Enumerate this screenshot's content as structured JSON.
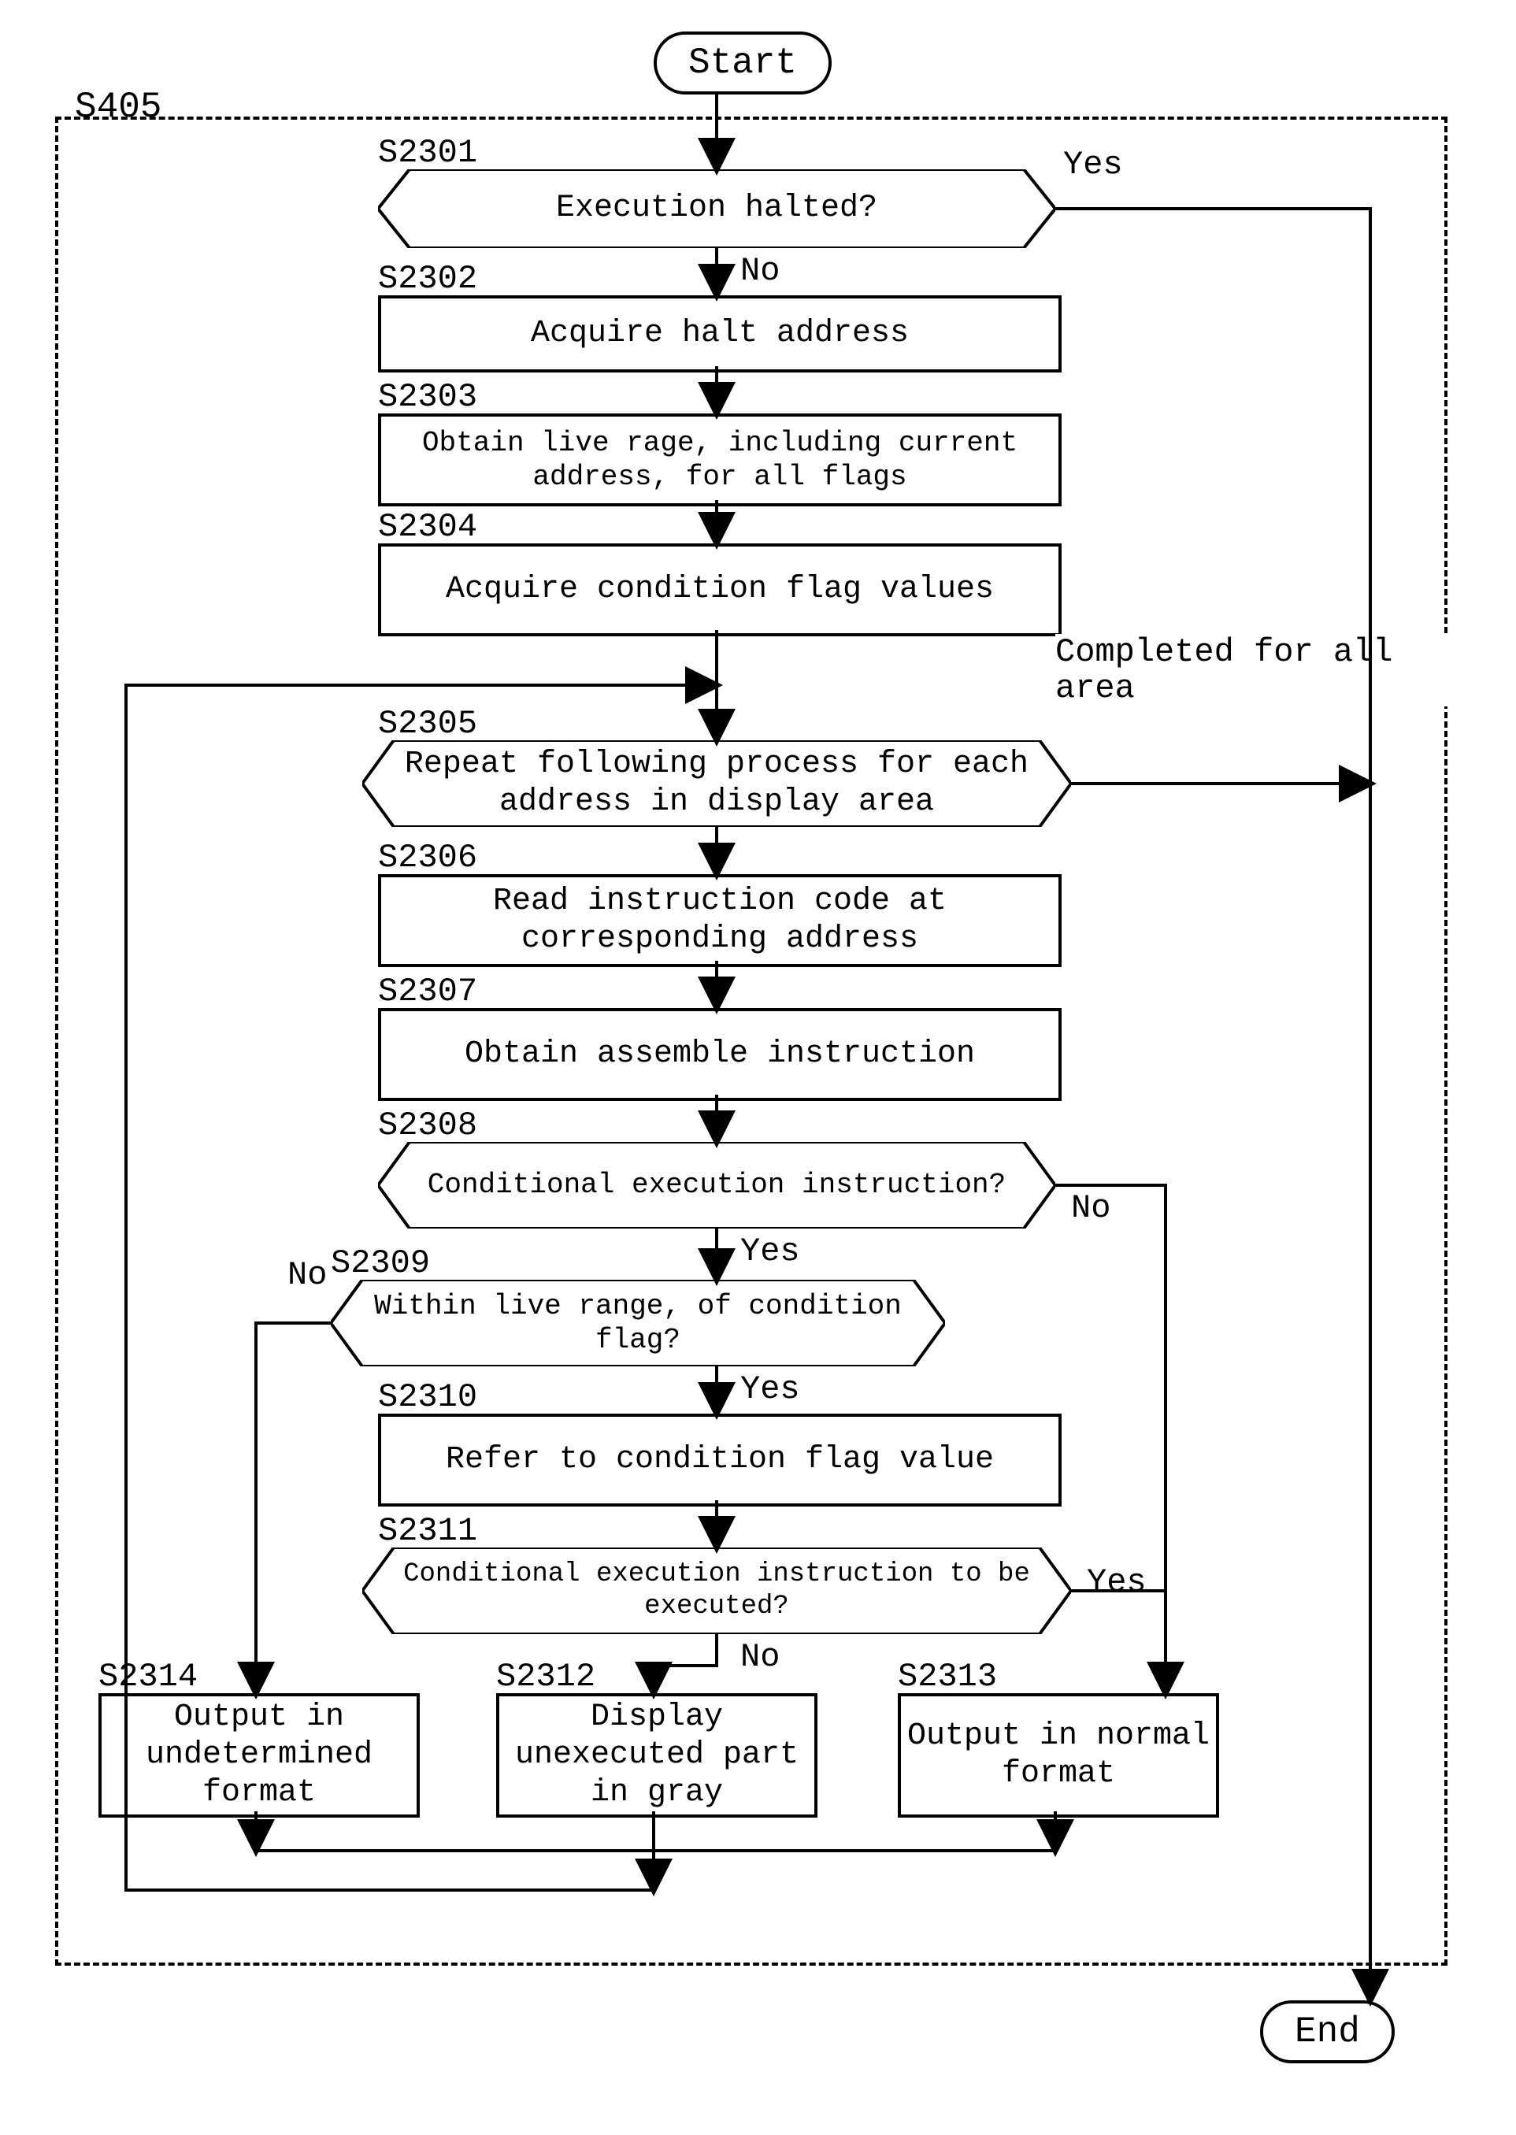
{
  "chart_data": {
    "type": "flowchart",
    "title": "S405",
    "nodes": [
      {
        "id": "start",
        "type": "terminal",
        "label": "Start"
      },
      {
        "id": "S2301",
        "type": "decision",
        "label": "Execution halted?",
        "step": "S2301"
      },
      {
        "id": "S2302",
        "type": "process",
        "label": "Acquire halt address",
        "step": "S2302"
      },
      {
        "id": "S2303",
        "type": "process",
        "label": "Obtain live rage, including current address, for all flags",
        "step": "S2303"
      },
      {
        "id": "S2304",
        "type": "process",
        "label": "Acquire condition flag values",
        "step": "S2304"
      },
      {
        "id": "S2305",
        "type": "loop",
        "label": "Repeat following process for each address in display area",
        "step": "S2305"
      },
      {
        "id": "S2306",
        "type": "process",
        "label": "Read instruction code at corresponding address",
        "step": "S2306"
      },
      {
        "id": "S2307",
        "type": "process",
        "label": "Obtain assemble instruction",
        "step": "S2307"
      },
      {
        "id": "S2308",
        "type": "decision",
        "label": "Conditional execution instruction?",
        "step": "S2308"
      },
      {
        "id": "S2309",
        "type": "decision",
        "label": "Within live range, of condition flag?",
        "step": "S2309"
      },
      {
        "id": "S2310",
        "type": "process",
        "label": "Refer to condition flag value",
        "step": "S2310"
      },
      {
        "id": "S2311",
        "type": "decision",
        "label": "Conditional execution instruction to be executed?",
        "step": "S2311"
      },
      {
        "id": "S2312",
        "type": "process",
        "label": "Display unexecuted part in gray",
        "step": "S2312"
      },
      {
        "id": "S2313",
        "type": "process",
        "label": "Output in normal format",
        "step": "S2313"
      },
      {
        "id": "S2314",
        "type": "process",
        "label": "Output in undetermined format",
        "step": "S2314"
      },
      {
        "id": "end",
        "type": "terminal",
        "label": "End"
      }
    ],
    "edges": [
      {
        "from": "start",
        "to": "S2301"
      },
      {
        "from": "S2301",
        "to": "end",
        "label": "Yes"
      },
      {
        "from": "S2301",
        "to": "S2302",
        "label": "No"
      },
      {
        "from": "S2302",
        "to": "S2303"
      },
      {
        "from": "S2303",
        "to": "S2304"
      },
      {
        "from": "S2304",
        "to": "S2305"
      },
      {
        "from": "S2305",
        "to": "S2306"
      },
      {
        "from": "S2305",
        "to": "end",
        "label": "Completed for all area"
      },
      {
        "from": "S2306",
        "to": "S2307"
      },
      {
        "from": "S2307",
        "to": "S2308"
      },
      {
        "from": "S2308",
        "to": "S2309",
        "label": "Yes"
      },
      {
        "from": "S2308",
        "to": "S2313",
        "label": "No"
      },
      {
        "from": "S2309",
        "to": "S2310",
        "label": "Yes"
      },
      {
        "from": "S2309",
        "to": "S2314",
        "label": "No"
      },
      {
        "from": "S2310",
        "to": "S2311"
      },
      {
        "from": "S2311",
        "to": "S2312",
        "label": "No"
      },
      {
        "from": "S2311",
        "to": "S2313",
        "label": "Yes"
      },
      {
        "from": "S2312",
        "to": "S2305"
      },
      {
        "from": "S2313",
        "to": "S2305"
      },
      {
        "from": "S2314",
        "to": "S2305"
      }
    ]
  },
  "labels": {
    "s405": "S405",
    "start": "Start",
    "end": "End",
    "yes": "Yes",
    "no": "No",
    "completed": "Completed for all area",
    "s2301": "S2301",
    "s2301_text": "Execution halted?",
    "s2302": "S2302",
    "s2302_text": "Acquire halt address",
    "s2303": "S2303",
    "s2303_text": "Obtain live rage, including current address, for all flags",
    "s2304": "S2304",
    "s2304_text": "Acquire condition flag values",
    "s2305": "S2305",
    "s2305_text": "Repeat following process for each address in display area",
    "s2306": "S2306",
    "s2306_text": "Read instruction code at corresponding address",
    "s2307": "S2307",
    "s2307_text": "Obtain assemble instruction",
    "s2308": "S2308",
    "s2308_text": "Conditional execution instruction?",
    "s2309": "S2309",
    "s2309_text": "Within live range, of condition flag?",
    "s2310": "S2310",
    "s2310_text": "Refer to condition flag value",
    "s2311": "S2311",
    "s2311_text": "Conditional execution instruction to be executed?",
    "s2312": "S2312",
    "s2312_text": "Display unexecuted part in gray",
    "s2313": "S2313",
    "s2313_text": "Output in normal format",
    "s2314": "S2314",
    "s2314_text": "Output in undetermined format"
  }
}
